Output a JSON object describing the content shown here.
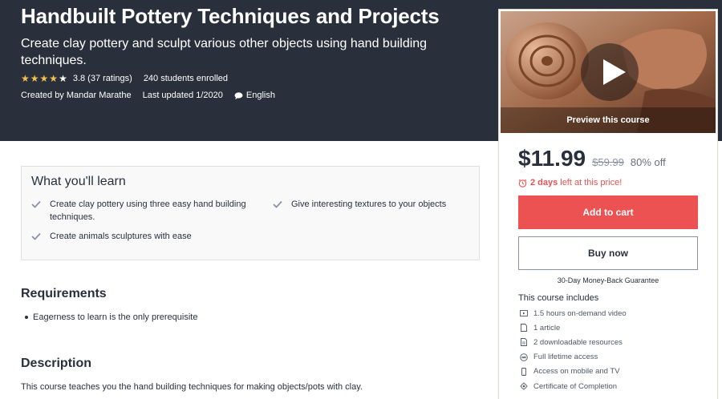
{
  "course": {
    "title": "Handbuilt Pottery Techniques and Projects",
    "subtitle": "Create clay pottery and sculpt various other objects using hand building techniques.",
    "rating_text": "3.8 (37 ratings)",
    "rating_value": 3.8,
    "rating_max": 5,
    "enrolled": "240 students enrolled",
    "created_by": "Created by Mandar Marathe",
    "last_updated": "Last updated 1/2020",
    "language": "English"
  },
  "sidebar": {
    "preview_label": "Preview this course",
    "price": "$11.99",
    "original_price": "$59.99",
    "discount": "80% off",
    "timer_bold": "2 days",
    "timer_rest": "left at this price!",
    "add_to_cart": "Add to cart",
    "buy_now": "Buy now",
    "guarantee": "30-Day Money-Back Guarantee",
    "includes_title": "This course includes",
    "includes": [
      {
        "icon": "video-icon",
        "label": "1.5 hours on-demand video"
      },
      {
        "icon": "article-icon",
        "label": "1 article"
      },
      {
        "icon": "download-icon",
        "label": "2 downloadable resources"
      },
      {
        "icon": "infinity-icon",
        "label": "Full lifetime access"
      },
      {
        "icon": "mobile-icon",
        "label": "Access on mobile and TV"
      },
      {
        "icon": "certificate-icon",
        "label": "Certificate of Completion"
      }
    ]
  },
  "learn": {
    "title": "What you'll learn",
    "items": [
      "Create clay pottery using three easy hand building techniques.",
      "Give interesting textures to your objects",
      "Create animals sculptures with ease"
    ]
  },
  "requirements": {
    "title": "Requirements",
    "items": [
      "Eagerness to learn is the only prerequisite"
    ]
  },
  "description": {
    "title": "Description",
    "text": "This course teaches you the hand building techniques for making objects/pots with clay."
  },
  "colors": {
    "hero_bg": "#29303b",
    "star": "#f4c150",
    "accent_red": "#ec5252",
    "check": "#8a92a3"
  }
}
